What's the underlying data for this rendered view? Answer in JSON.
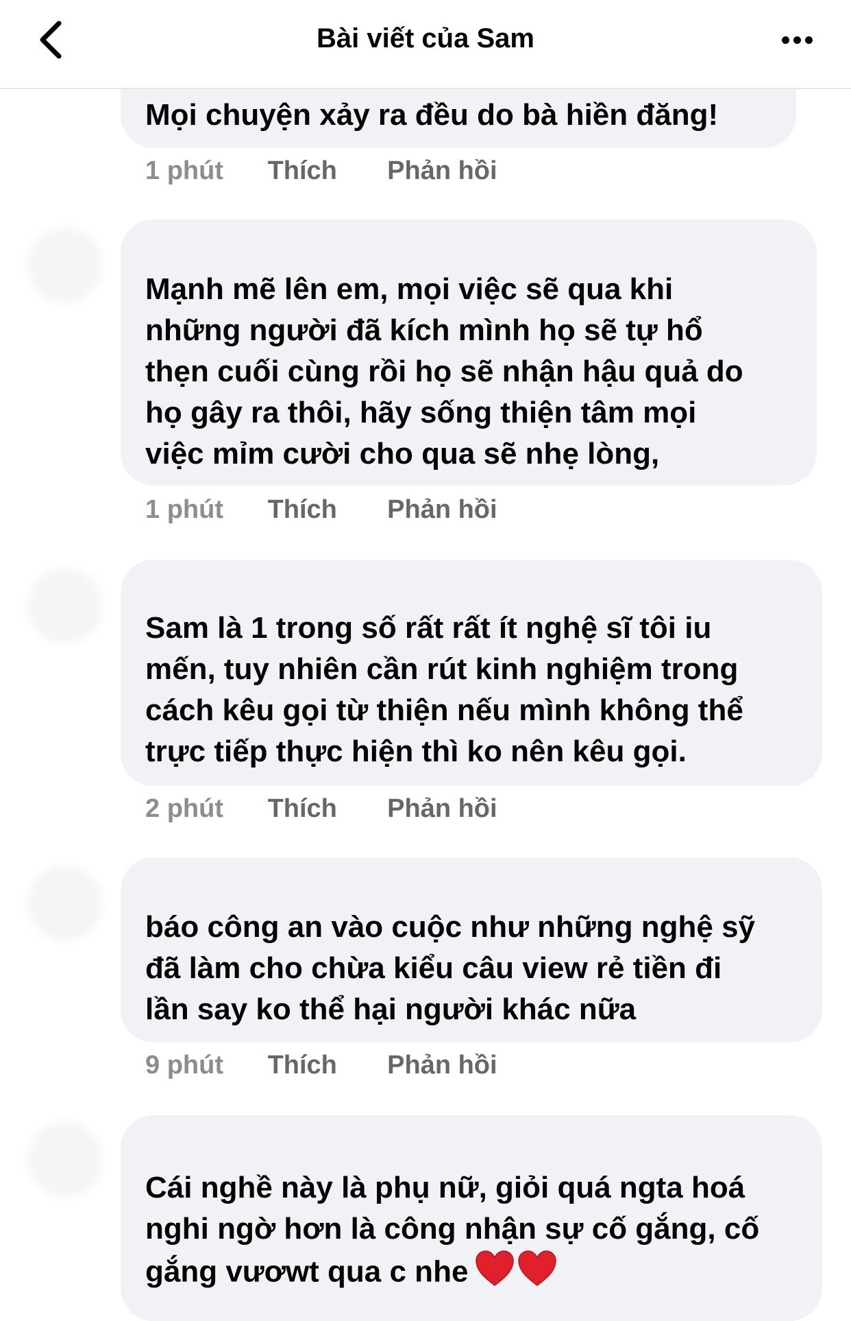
{
  "header": {
    "back_icon": "chevron-left-icon",
    "title": "Bài viết của Sam",
    "more_icon": "more-horizontal-icon"
  },
  "comments": [
    {
      "author": "",
      "lines": [
        "Mọi chuyện xảy ra đều do bà hiền đăng!"
      ],
      "time": "1 phút",
      "like": "Thích",
      "reply": "Phản hồi"
    },
    {
      "author": "",
      "lines": [
        "Mạnh mẽ lên em, mọi việc sẽ qua khi",
        "những người đã kích mình họ sẽ tự hổ",
        "thẹn cuối cùng rồi họ sẽ nhận hậu quả do",
        "họ gây ra thôi, hãy sống thiện tâm mọi",
        "việc mỉm cười cho qua sẽ nhẹ lòng,"
      ],
      "time": "1 phút",
      "like": "Thích",
      "reply": "Phản hồi"
    },
    {
      "author": "",
      "lines": [
        "Sam là 1 trong số rất rất ít nghệ sĩ tôi iu",
        "mến, tuy nhiên cần rút kinh nghiệm trong",
        "cách kêu gọi từ thiện nếu mình không thể",
        "trực tiếp thực hiện thì ko nên kêu gọi."
      ],
      "time": "2 phút",
      "like": "Thích",
      "reply": "Phản hồi"
    },
    {
      "author": "",
      "lines": [
        "báo công an vào cuộc như những nghệ sỹ",
        "đã làm cho chừa kiểu câu view rẻ tiền đi",
        "lần say ko thể hại người khác nữa"
      ],
      "time": "9 phút",
      "like": "Thích",
      "reply": "Phản hồi"
    },
    {
      "author": "",
      "lines": [
        "Cái nghề này là phụ nữ, giỏi quá ngta hoá",
        "nghi ngờ hơn là công nhận sự cố gắng, cố",
        "gắng vươwt qua c nhe"
      ],
      "emoji": [
        "red-heart-icon",
        "red-heart-icon"
      ]
    }
  ],
  "colors": {
    "bubble_bg": "#f0f2f5",
    "text": "#050505",
    "meta": "#65676b",
    "heart": "#e0202b"
  }
}
